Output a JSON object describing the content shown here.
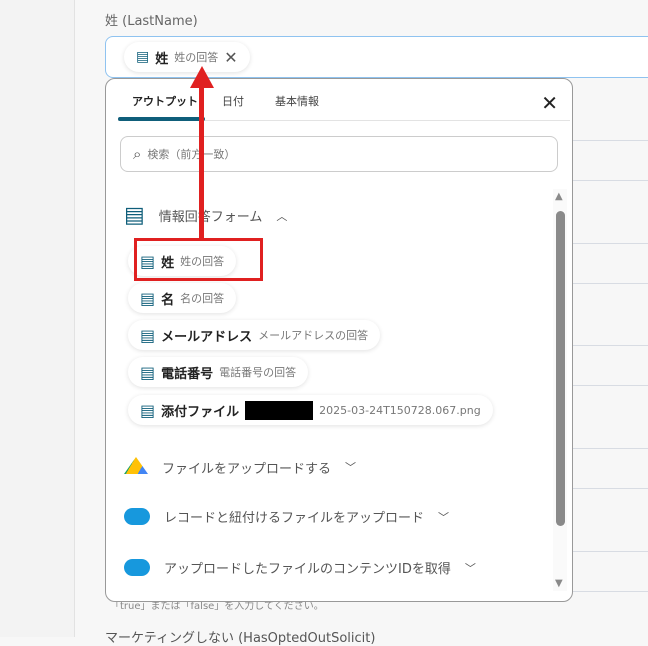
{
  "field": {
    "label": "姓 (LastName)",
    "chip": {
      "key": "姓",
      "value": "姓の回答"
    }
  },
  "popup": {
    "tabs": [
      "アウトプット",
      "日付",
      "基本情報"
    ],
    "search_placeholder": "検索（前方一致）",
    "groups": [
      {
        "title": "情報回答フォーム",
        "icon": "form-icon",
        "expanded": true,
        "items": [
          {
            "key": "姓",
            "value": "姓の回答"
          },
          {
            "key": "名",
            "value": "名の回答"
          },
          {
            "key": "メールアドレス",
            "value": "メールアドレスの回答"
          },
          {
            "key": "電話番号",
            "value": "電話番号の回答"
          },
          {
            "key": "添付ファイル",
            "value": "2025-03-24T150728.067.png"
          }
        ]
      },
      {
        "title": "ファイルをアップロードする",
        "icon": "google-drive-icon"
      },
      {
        "title": "レコードと紐付けるファイルをアップロード",
        "icon": "salesforce-icon"
      },
      {
        "title": "アップロードしたファイルのコンテンツIDを取得",
        "icon": "salesforce-icon"
      }
    ]
  },
  "footnote": "「true」または「false」を入力してください。",
  "next_label": "マーケティングしない (HasOptedOutSolicit)",
  "colors": {
    "accent": "#0f5e7a",
    "annotation": "#e02020",
    "field_border": "#8fc3f0"
  }
}
